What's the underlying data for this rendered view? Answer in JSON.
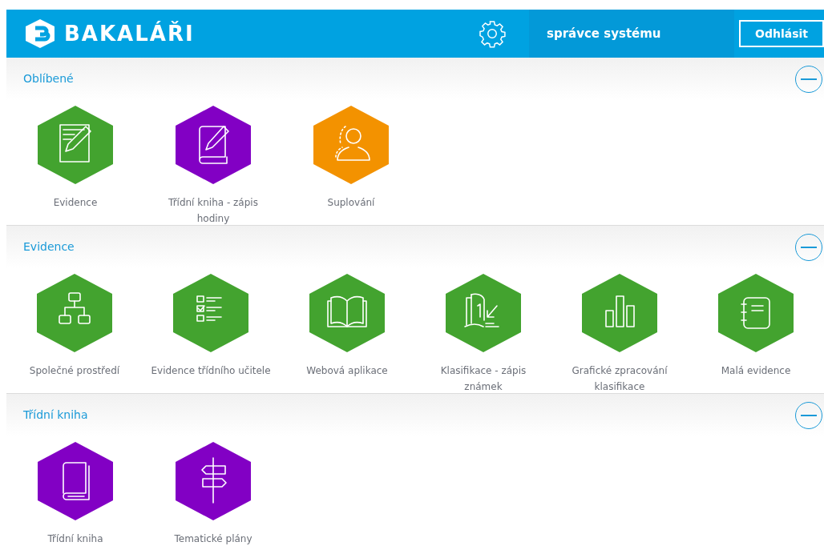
{
  "header": {
    "logo": "BAKALÁŘI",
    "user": "správce systému",
    "logout": "Odhlásit"
  },
  "sections": [
    {
      "title": "Oblíbené",
      "expanded": true,
      "tiles": [
        {
          "label": "Evidence",
          "kind": "notepad",
          "color": "#43a32f"
        },
        {
          "label": "Třídní kniha - zápis hodiny",
          "kind": "book-pencil",
          "color": "#8200c4"
        },
        {
          "label": "Suplování",
          "kind": "person",
          "color": "#f39200"
        }
      ]
    },
    {
      "title": "Evidence",
      "expanded": true,
      "tiles": [
        {
          "label": "Společné prostředí",
          "kind": "hierarchy",
          "color": "#43a32f"
        },
        {
          "label": "Evidence třídního učitele",
          "kind": "checklist",
          "color": "#43a32f"
        },
        {
          "label": "Webová aplikace",
          "kind": "open-book",
          "color": "#43a32f"
        },
        {
          "label": "Klasifikace - zápis známek",
          "kind": "grades",
          "color": "#43a32f"
        },
        {
          "label": "Grafické zpracování klasifikace",
          "kind": "bars",
          "color": "#43a32f"
        },
        {
          "label": "Malá evidence",
          "kind": "notebook",
          "color": "#43a32f"
        }
      ]
    },
    {
      "title": "Třídní kniha",
      "expanded": true,
      "tiles": [
        {
          "label": "Třídní kniha",
          "kind": "book",
          "color": "#8200c4"
        },
        {
          "label": "Tematické plány",
          "kind": "signpost",
          "color": "#8200c4"
        }
      ]
    }
  ]
}
